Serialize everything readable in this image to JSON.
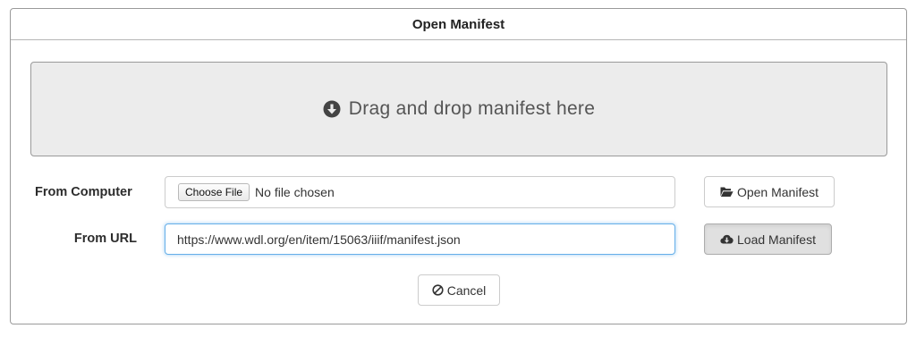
{
  "dialog": {
    "title": "Open Manifest",
    "dropzone": {
      "label": "Drag and drop manifest here",
      "icon": "arrow-circle-down-icon"
    },
    "from_computer": {
      "label": "From Computer",
      "choose_file_label": "Choose File",
      "file_status": "No file chosen",
      "open_button": {
        "label": "Open Manifest",
        "icon": "folder-open-icon"
      }
    },
    "from_url": {
      "label": "From URL",
      "value": "https://www.wdl.org/en/item/15063/iiif/manifest.json",
      "load_button": {
        "label": "Load Manifest",
        "icon": "cloud-download-icon"
      }
    },
    "cancel_button": {
      "label": "Cancel",
      "icon": "ban-icon"
    }
  },
  "colors": {
    "focus_border": "#66afe9",
    "dropzone_background": "#ececec",
    "pressed_button_background": "#e0e0e0"
  }
}
